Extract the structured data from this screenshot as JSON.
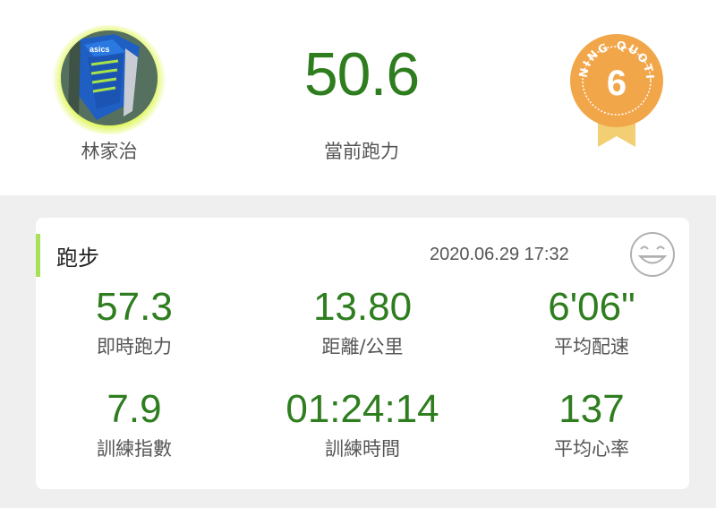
{
  "profile": {
    "name": "林家治"
  },
  "summary": {
    "value": "50.6",
    "label": "當前跑力"
  },
  "badge": {
    "arc_text": "RUNNING QUOTIENT",
    "number": "6",
    "color": "#f2a64a"
  },
  "activity": {
    "title": "跑步",
    "datetime": "2020.06.29 17:32",
    "accent_color": "#a8e05a",
    "stats": [
      {
        "value": "57.3",
        "label": "即時跑力"
      },
      {
        "value": "13.80",
        "label": "距離/公里"
      },
      {
        "value": "6'06\"",
        "label": "平均配速"
      },
      {
        "value": "7.9",
        "label": "訓練指數"
      },
      {
        "value": "01:24:14",
        "label": "訓練時間"
      },
      {
        "value": "137",
        "label": "平均心率"
      }
    ]
  },
  "colors": {
    "value_green": "#2e7d1e",
    "background": "#efefef"
  }
}
